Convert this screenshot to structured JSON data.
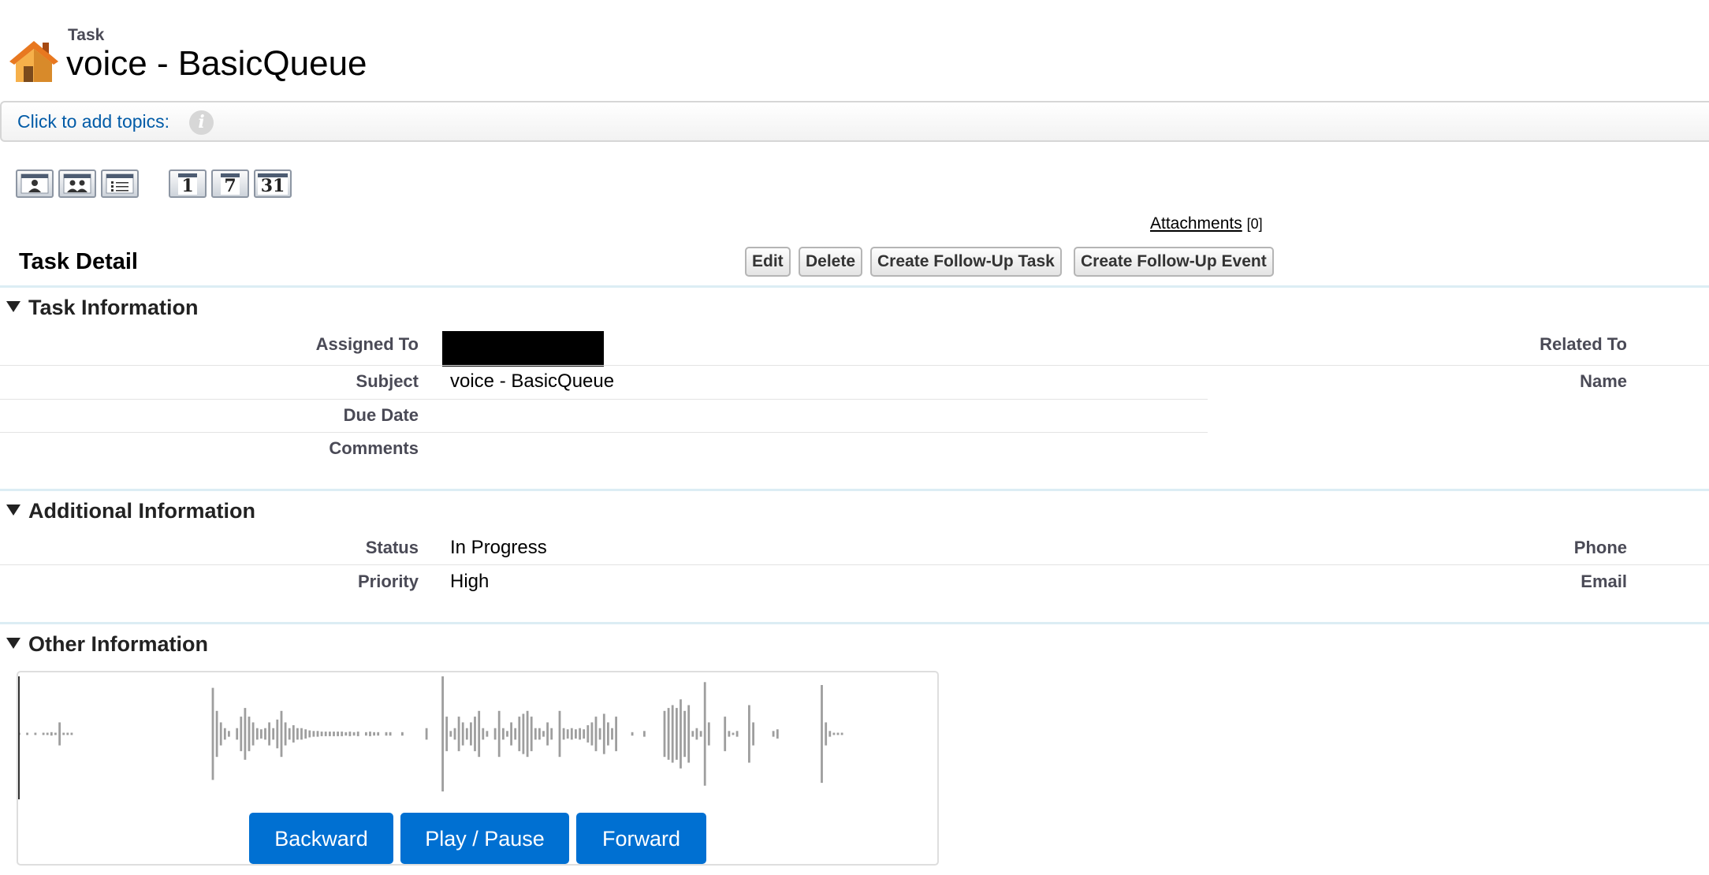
{
  "header": {
    "entity_label": "Task",
    "title": "voice - BasicQueue",
    "icon": "house-icon"
  },
  "topics": {
    "link_label": "Click to add topics:",
    "info_glyph": "i"
  },
  "toolbar": {
    "view_buttons": [
      "single-user-view-icon",
      "multi-user-view-icon",
      "list-view-icon"
    ],
    "day_label": "1",
    "week_label": "7",
    "month_label": "31"
  },
  "attachments": {
    "label": "Attachments",
    "count": "[0]"
  },
  "detail": {
    "title": "Task Detail",
    "buttons": {
      "edit": "Edit",
      "delete": "Delete",
      "follow_up_task": "Create Follow-Up Task",
      "follow_up_event": "Create Follow-Up Event"
    }
  },
  "task_information": {
    "heading": "Task Information",
    "assigned_to_label": "Assigned To",
    "assigned_to_value": "",
    "subject_label": "Subject",
    "subject_value": "voice - BasicQueue",
    "due_date_label": "Due Date",
    "due_date_value": "",
    "comments_label": "Comments",
    "comments_value": "",
    "related_to_label": "Related To",
    "name_label": "Name"
  },
  "additional_information": {
    "heading": "Additional Information",
    "status_label": "Status",
    "status_value": "In Progress",
    "priority_label": "Priority",
    "priority_value": "High",
    "phone_label": "Phone",
    "email_label": "Email"
  },
  "other_information": {
    "heading": "Other Information",
    "player": {
      "backward_label": "Backward",
      "play_pause_label": "Play / Pause",
      "forward_label": "Forward",
      "playback_position": 0,
      "waveform_amplitudes": [
        0.02,
        0,
        0.02,
        0,
        0.02,
        0,
        0.02,
        0.02,
        0.03,
        0.02,
        0.2,
        0.02,
        0.02,
        0.02,
        0,
        0,
        0,
        0,
        0,
        0,
        0,
        0,
        0,
        0,
        0,
        0,
        0,
        0,
        0,
        0,
        0,
        0,
        0,
        0,
        0,
        0,
        0,
        0,
        0,
        0,
        0,
        0,
        0,
        0,
        0,
        0,
        0,
        0,
        0.8,
        0.4,
        0.2,
        0.1,
        0.05,
        0,
        0.1,
        0.3,
        0.45,
        0.3,
        0.2,
        0.1,
        0.08,
        0.1,
        0.2,
        0.1,
        0.25,
        0.4,
        0.2,
        0.1,
        0.15,
        0.1,
        0.1,
        0.08,
        0.06,
        0.05,
        0.05,
        0.04,
        0.04,
        0.04,
        0.04,
        0.04,
        0.04,
        0.03,
        0.04,
        0.03,
        0.04,
        0,
        0.03,
        0.04,
        0.03,
        0.03,
        0,
        0.03,
        0.03,
        0,
        0,
        0.03,
        0,
        0,
        0,
        0,
        0,
        0.1,
        0,
        0,
        0,
        1,
        0.3,
        0.05,
        0.1,
        0.3,
        0.2,
        0.1,
        0.2,
        0.3,
        0.4,
        0.1,
        0.05,
        0,
        0.1,
        0.4,
        0.1,
        0.05,
        0.2,
        0.1,
        0.3,
        0.35,
        0.4,
        0.3,
        0.1,
        0.1,
        0.05,
        0.2,
        0.1,
        0,
        0.4,
        0.1,
        0.08,
        0.1,
        0.08,
        0.1,
        0.08,
        0.15,
        0.2,
        0.3,
        0.1,
        0.35,
        0.2,
        0.1,
        0.3,
        0,
        0,
        0,
        0.03,
        0,
        0,
        0.05,
        0,
        0,
        0,
        0,
        0.4,
        0.45,
        0.5,
        0.45,
        0.6,
        0.4,
        0.5,
        0.05,
        0.1,
        0.05,
        0.9,
        0.2,
        0,
        0,
        0,
        0.3,
        0.05,
        0.02,
        0.05,
        0,
        0,
        0.5,
        0.2,
        0,
        0,
        0,
        0,
        0.05,
        0.08,
        0,
        0,
        0,
        0,
        0,
        0,
        0,
        0,
        0,
        0,
        0.85,
        0.2,
        0.05,
        0.02,
        0.02,
        0.02,
        0,
        0,
        0,
        0,
        0,
        0,
        0,
        0,
        0,
        0
      ]
    }
  }
}
